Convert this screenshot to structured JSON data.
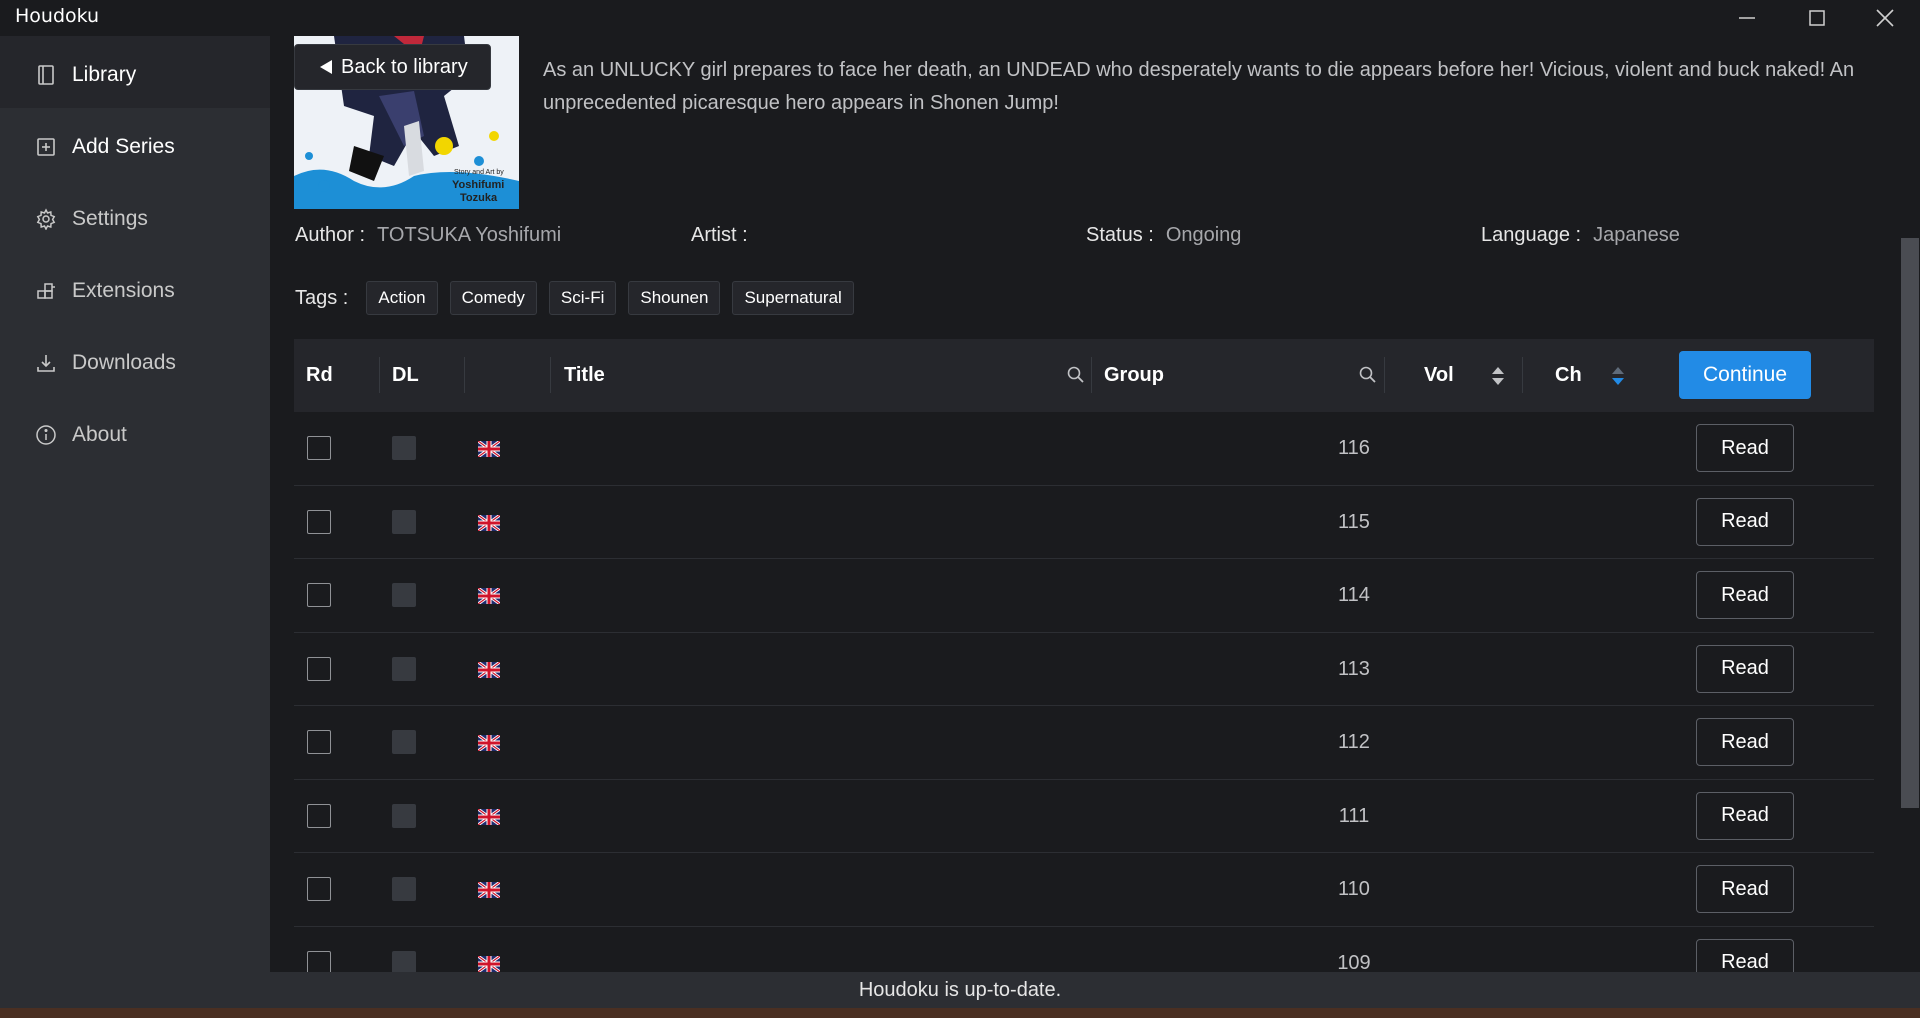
{
  "window": {
    "title": "Houdoku"
  },
  "sidebar": {
    "items": [
      {
        "label": "Library",
        "icon": "book-icon"
      },
      {
        "label": "Add Series",
        "icon": "plus-square-icon"
      },
      {
        "label": "Settings",
        "icon": "gear-icon"
      },
      {
        "label": "Extensions",
        "icon": "puzzle-icon"
      },
      {
        "label": "Downloads",
        "icon": "download-icon"
      },
      {
        "label": "About",
        "icon": "info-icon"
      }
    ]
  },
  "series": {
    "back_label": "Back to library",
    "cover_credit_line1": "Story and Art by",
    "cover_credit_line2": "Yoshifumi",
    "cover_credit_line3": "Tozuka",
    "description": "As an UNLUCKY girl prepares to face her death, an UNDEAD who desperately wants to die appears before her! Vicious, violent and buck naked! An unprecedented picaresque hero appears in Shonen Jump!",
    "author_label": "Author :",
    "author": "TOTSUKA Yoshifumi",
    "artist_label": "Artist :",
    "artist": "",
    "status_label": "Status :",
    "status": "Ongoing",
    "language_label": "Language :",
    "language": "Japanese",
    "tags_label": "Tags :",
    "tags": [
      "Action",
      "Comedy",
      "Sci-Fi",
      "Shounen",
      "Supernatural"
    ]
  },
  "table": {
    "headers": {
      "read": "Rd",
      "download": "DL",
      "title": "Title",
      "group": "Group",
      "volume": "Vol",
      "chapter": "Ch"
    },
    "continue_label": "Continue",
    "read_label": "Read",
    "rows": [
      {
        "chapter": "116",
        "flag": "uk-flag-icon"
      },
      {
        "chapter": "115",
        "flag": "uk-flag-icon"
      },
      {
        "chapter": "114",
        "flag": "uk-flag-icon"
      },
      {
        "chapter": "113",
        "flag": "uk-flag-icon"
      },
      {
        "chapter": "112",
        "flag": "uk-flag-icon"
      },
      {
        "chapter": "111",
        "flag": "uk-flag-icon"
      },
      {
        "chapter": "110",
        "flag": "uk-flag-icon"
      },
      {
        "chapter": "109",
        "flag": "uk-flag-icon"
      }
    ]
  },
  "statusbar": {
    "text": "Houdoku is up-to-date."
  },
  "colors": {
    "accent": "#228be6",
    "background": "#1a1b1e",
    "sidebar": "#2c2e33"
  }
}
